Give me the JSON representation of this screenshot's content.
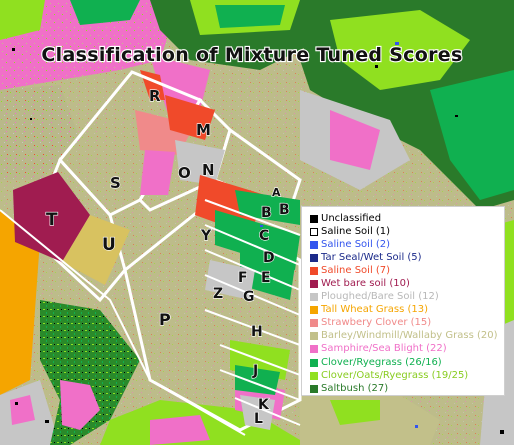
{
  "map": {
    "title": "Classification of Mixture Tuned Scores",
    "field_labels": [
      "R",
      "M",
      "S",
      "O",
      "N",
      "T",
      "U",
      "A",
      "B",
      "B",
      "C",
      "D",
      "E",
      "Y",
      "F",
      "G",
      "Z",
      "P",
      "H",
      "J",
      "K",
      "L"
    ]
  },
  "legend": {
    "entries": [
      {
        "label": "Unclassified",
        "swatch": "#000000",
        "text_color": "#000000"
      },
      {
        "label": "Saline Soil (1)",
        "swatch": "#ffffff",
        "text_color": "#000000"
      },
      {
        "label": "Saline Soil (2)",
        "swatch": "#3355ee",
        "text_color": "#3355ee"
      },
      {
        "label": "Tar Seal/Wet Soil (5)",
        "swatch": "#1b2a8a",
        "text_color": "#1b2a8a"
      },
      {
        "label": "Saline Soil (7)",
        "swatch": "#f04a2a",
        "text_color": "#f04a2a"
      },
      {
        "label": "Wet bare soil (10)",
        "swatch": "#a01c50",
        "text_color": "#a01c50"
      },
      {
        "label": "Ploughed/Bare Soil (12)",
        "swatch": "#c6c6c6",
        "text_color": "#b8b8b8"
      },
      {
        "label": "Tall Wheat Grass (13)",
        "swatch": "#f5a500",
        "text_color": "#f5a500"
      },
      {
        "label": "Strawbery Clover (15)",
        "swatch": "#f08a8a",
        "text_color": "#f08a8a"
      },
      {
        "label": "Barley/Windmill/Wallaby Grass (20)",
        "swatch": "#c2c08a",
        "text_color": "#c2c08a"
      },
      {
        "label": "Samphire/Sea Blight (22)",
        "swatch": "#f070c8",
        "text_color": "#f070c8"
      },
      {
        "label": "Clover/Ryegrass (26/16)",
        "swatch": "#10b050",
        "text_color": "#10b050"
      },
      {
        "label": "Clover/Oats/Ryegrass (19/25)",
        "swatch": "#90e020",
        "text_color": "#88cc20"
      },
      {
        "label": "Saltbush (27)",
        "swatch": "#2a7a2a",
        "text_color": "#2a7a2a"
      }
    ]
  },
  "colors": {
    "saline_soil_1": "#ffffff",
    "saline_soil_2": "#3355ee",
    "tar_seal_wet_soil_5": "#1b2a8a",
    "saline_soil_7": "#f04a2a",
    "wet_bare_soil_10": "#a01c50",
    "ploughed_bare_soil_12": "#c6c6c6",
    "tall_wheat_grass_13": "#f5a500",
    "strawbery_clover_15": "#f08a8a",
    "barley_windmill_wallaby_grass_20": "#c2c08a",
    "samphire_sea_blight_22": "#f070c8",
    "clover_ryegrass_26_16": "#10b050",
    "clover_oats_ryegrass_19_25": "#90e020",
    "saltbush_27": "#2a7a2a",
    "unclassified": "#000000"
  }
}
